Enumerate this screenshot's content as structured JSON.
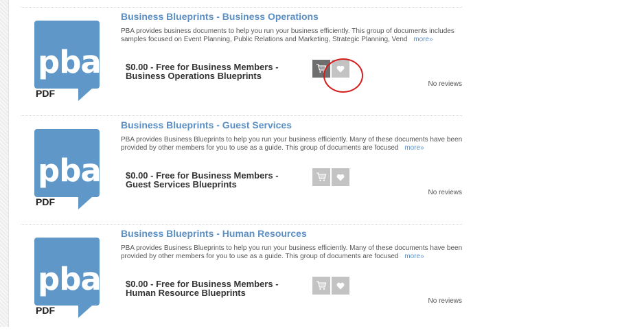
{
  "products": [
    {
      "title": "Business Blueprints - Business Operations",
      "thumb_logo": "pba",
      "thumb_label": "PDF",
      "description": "PBA provides business documents to help you run your business efficiently. This group of documents includes samples focused on Event Planning, Public Relations and Marketing, Strategic Planning, Vend",
      "more_label": "more»",
      "price_line1": "$0.00 - Free for Business Members -",
      "price_line2": "Business Operations Blueprints",
      "cart_icon": "cart-icon",
      "wishlist_icon": "heart-icon",
      "reviews": "No reviews"
    },
    {
      "title": "Business Blueprints - Guest Services",
      "thumb_logo": "pba",
      "thumb_label": "PDF",
      "description": "PBA provides Business Blueprints to help you run your business efficiently. Many of these documents have been provided by other members for you to use as a guide. This group of documents are focused",
      "more_label": "more»",
      "price_line1": "$0.00 - Free for Business Members -",
      "price_line2": "Guest Services Blueprints",
      "cart_icon": "cart-icon",
      "wishlist_icon": "heart-icon",
      "reviews": "No reviews"
    },
    {
      "title": "Business Blueprints - Human Resources",
      "thumb_logo": "pba",
      "thumb_label": "PDF",
      "description": "PBA provides Business Blueprints to help you run your business efficiently. Many of these documents have been provided by other members for you to use as a guide. This group of documents are focused",
      "more_label": "more»",
      "price_line1": "$0.00 - Free for Business Members -",
      "price_line2": "Human Resource Blueprints",
      "cart_icon": "cart-icon",
      "wishlist_icon": "heart-icon",
      "reviews": "No reviews"
    }
  ],
  "colors": {
    "link": "#5b8fc4",
    "logo_blue": "#5e97c8",
    "button_gray": "#c3c3c3",
    "button_active": "#6e6e6e",
    "annotation_ring": "#d61d1d"
  }
}
